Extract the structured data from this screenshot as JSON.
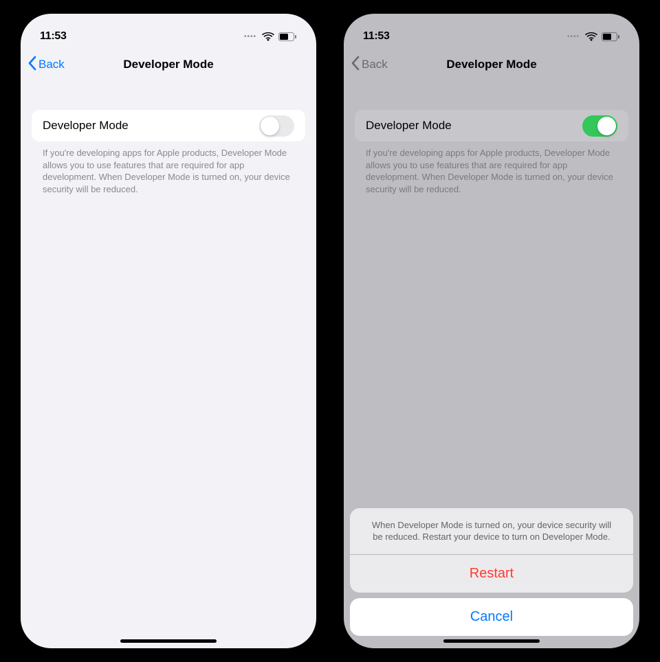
{
  "statusBar": {
    "time": "11:53"
  },
  "nav": {
    "back": "Back",
    "title": "Developer Mode"
  },
  "row": {
    "label": "Developer Mode"
  },
  "description": "If you're developing apps for Apple products, Developer Mode allows you to use features that are required for app development. When Developer Mode is turned on, your device security will be reduced.",
  "sheet": {
    "message": "When Developer Mode is turned on, your device security will be reduced. Restart your device to turn on Developer Mode.",
    "restart": "Restart",
    "cancel": "Cancel"
  },
  "left": {
    "toggle": "off"
  },
  "right": {
    "toggle": "on"
  }
}
